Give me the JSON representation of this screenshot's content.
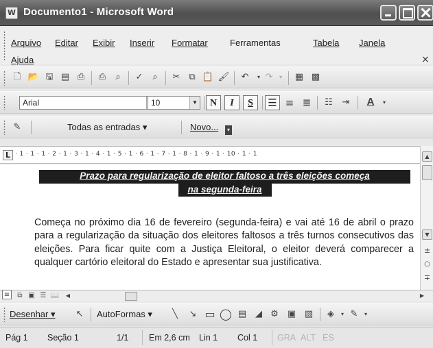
{
  "window": {
    "title": "Documento1 - Microsoft Word",
    "app_icon": "W"
  },
  "menu": {
    "items": [
      "Arquivo",
      "Editar",
      "Exibir",
      "Inserir",
      "Formatar",
      "Ferramentas",
      "Tabela",
      "Janela",
      "Ajuda"
    ],
    "close_glyph": "×"
  },
  "format_toolbar": {
    "font": "Arial",
    "size": "10",
    "bold": "N",
    "italic": "I",
    "underline": "S"
  },
  "review_toolbar": {
    "show": "Todas as entradas ▾",
    "new_comment": "Novo..."
  },
  "ruler": {
    "marks": "· 1 · 1 · 1 · 2 · 1 · 3 · 1 · 4 · 1 · 5 · 1 · 6 · 1 · 7 · 1 · 8 · 1 · 9 · 1 · 10 · 1 · 1"
  },
  "document": {
    "headline_line1": "Prazo para regularização de eleitor faltoso a três eleições começa",
    "headline_line2": "na segunda-feira",
    "body": "Começa no próximo dia 16 de fevereiro (segunda-feira) e vai até 16 de abril o prazo para a regularização da situação dos eleitores faltosos a três turnos consecutivos das eleições.  Para ficar quite com a Justiça Eleitoral, o eleitor deverá comparecer a qualquer cartório eleitoral do Estado e apresentar sua justificativa."
  },
  "drawing_toolbar": {
    "draw": "Desenhar ▾",
    "autoshapes": "AutoFormas ▾"
  },
  "status": {
    "page": "Pág 1",
    "section": "Seção 1",
    "pages": "1/1",
    "at": "Em 2,6 cm",
    "line": "Lin 1",
    "col": "Col 1",
    "rec": "GRA",
    "trk": "ALT",
    "ext": "ES"
  },
  "icons": [
    "new-document-icon",
    "open-icon",
    "save-icon",
    "permission-icon",
    "print-icon",
    "print-preview-icon",
    "spelling-icon",
    "research-icon",
    "cut-icon",
    "copy-icon",
    "paste-icon",
    "format-painter-icon",
    "undo-icon",
    "redo-icon",
    "table-icon",
    "excel-icon"
  ]
}
